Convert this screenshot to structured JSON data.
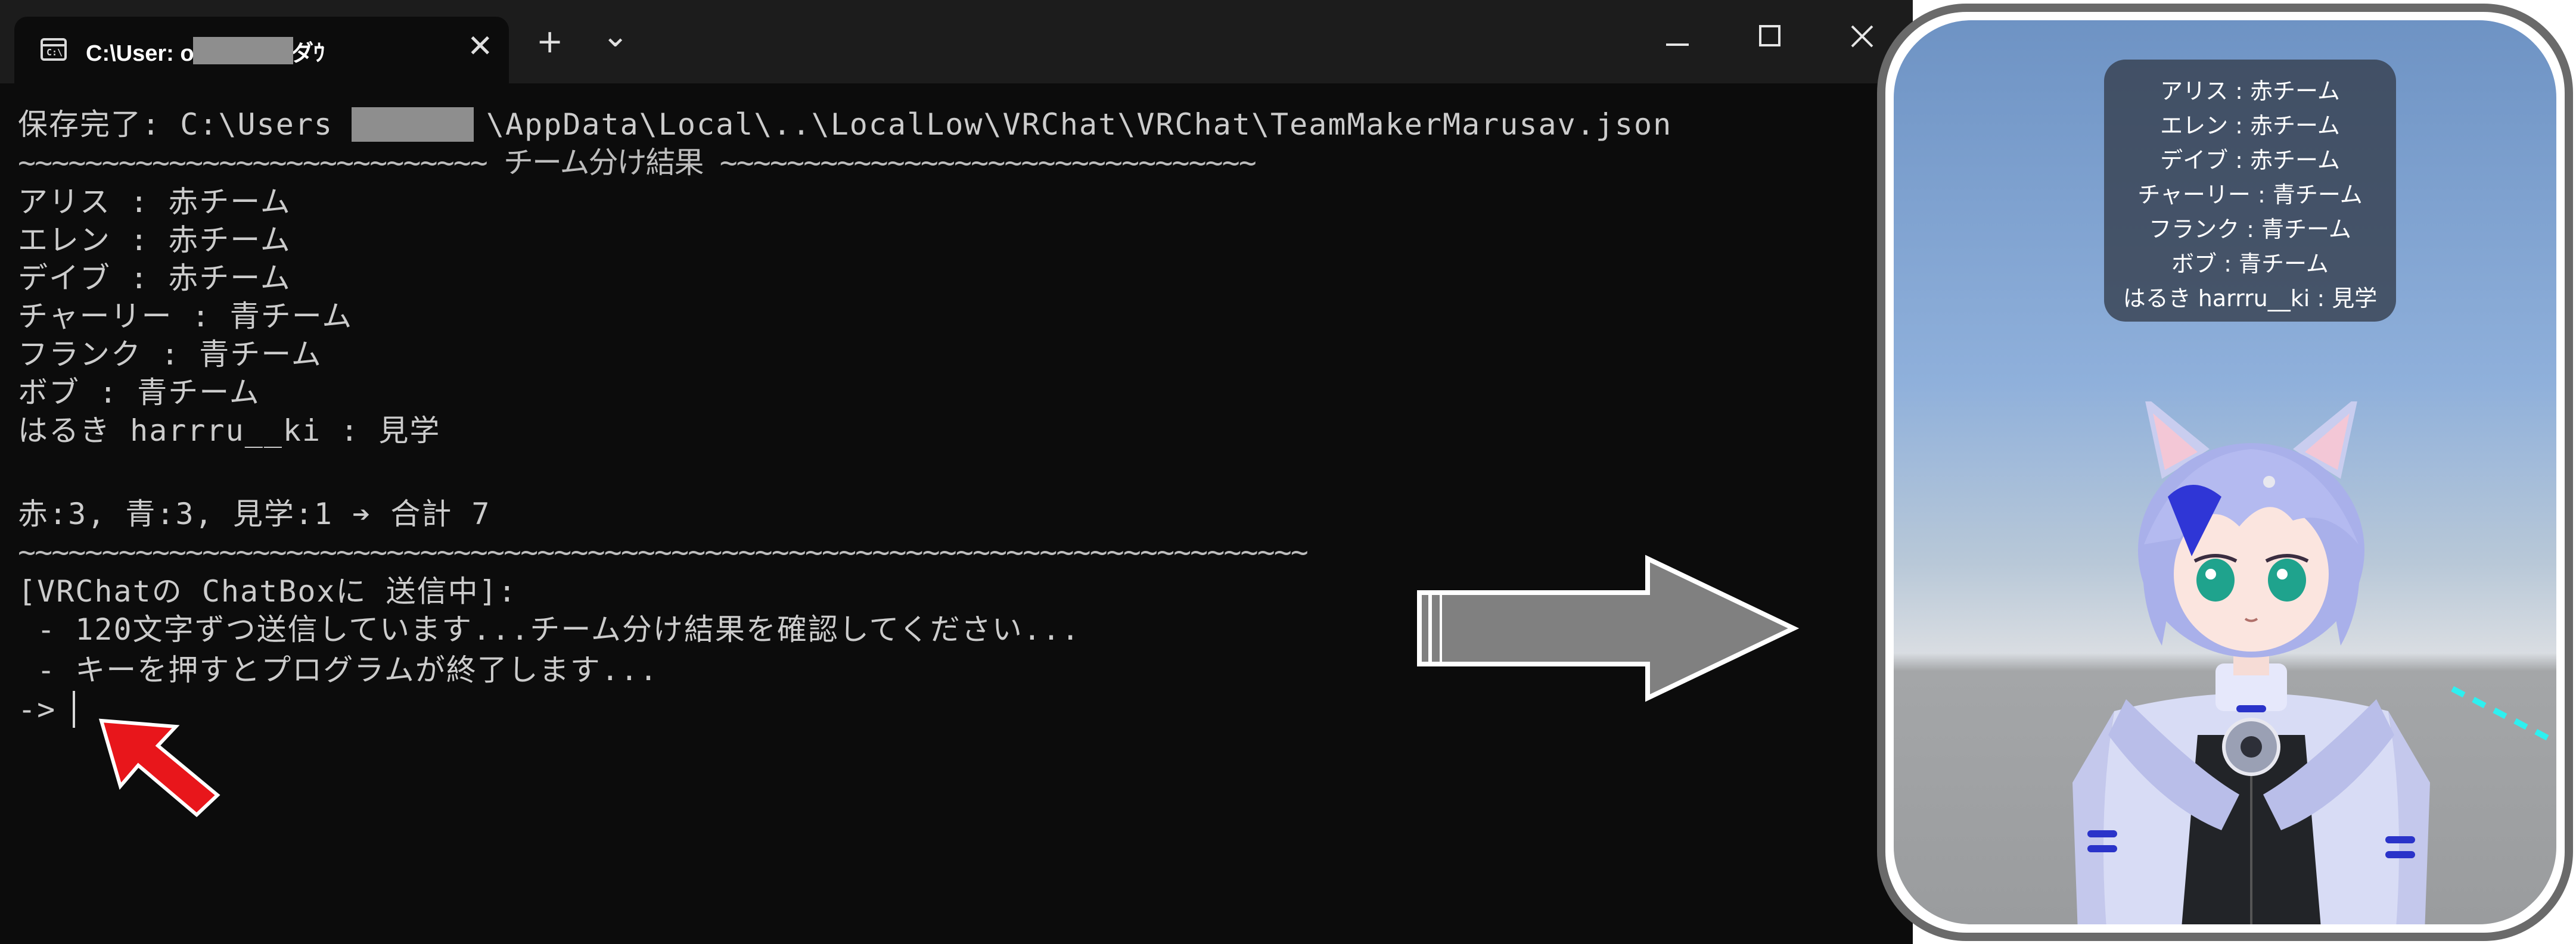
{
  "window": {
    "tab_title": "C:\\User:           ownloads\\ダｳ",
    "new_tab_label": "+",
    "dropdown_label": "⌄",
    "close_tab_label": "✕"
  },
  "terminal": {
    "lines": [
      "保存完了: C:\\Users        \\AppData\\Local\\..\\LocalLow\\VRChat\\VRChat\\TeamMakerMarusav.json",
      "~~~~~~~~~~~~~~~~~~~~~~~~~~~~ チーム分け結果 ~~~~~~~~~~~~~~~~~~~~~~~~~~~~~~~~",
      "アリス : 赤チーム",
      "エレン : 赤チーム",
      "デイブ : 赤チーム",
      "チャーリー : 青チーム",
      "フランク : 青チーム",
      "ボブ : 青チーム",
      "はるき harrru__ki : 見学",
      "",
      "赤:3, 青:3, 見学:1 ➔ 合計 7",
      "~~~~~~~~~~~~~~~~~~~~~~~~~~~~~~~~~~~~~~~~~~~~~~~~~~~~~~~~~~~~~~~~~~~~~~~~~~~~~",
      "[VRChatの ChatBoxに 送信中]:",
      " - 120文字ずつ送信しています...チーム分け結果を確認してください...",
      " - キーを押すとプログラムが終了します...",
      "->"
    ]
  },
  "chatbox": {
    "lines": [
      "アリス : 赤チーム",
      "エレン : 赤チーム",
      "デイブ : 赤チーム",
      "チャーリー : 青チーム",
      "フランク : 青チーム",
      "ボブ : 青チーム",
      "はるき harrru__ki : 見学"
    ]
  },
  "colors": {
    "terminal_bg": "#0c0c0c",
    "terminal_text": "#cccccc",
    "titlebar_bg": "#1c1c1c",
    "annotation_arrow_red": "#e8161b",
    "annotation_arrow_gray": "#808080",
    "panel_border": "#6a6a6a",
    "chatbox_bg": "#374150"
  },
  "icons": [
    "terminal-icon",
    "minimize-icon",
    "maximize-icon",
    "close-icon",
    "cursor-pointer-arrow",
    "right-arrow"
  ]
}
